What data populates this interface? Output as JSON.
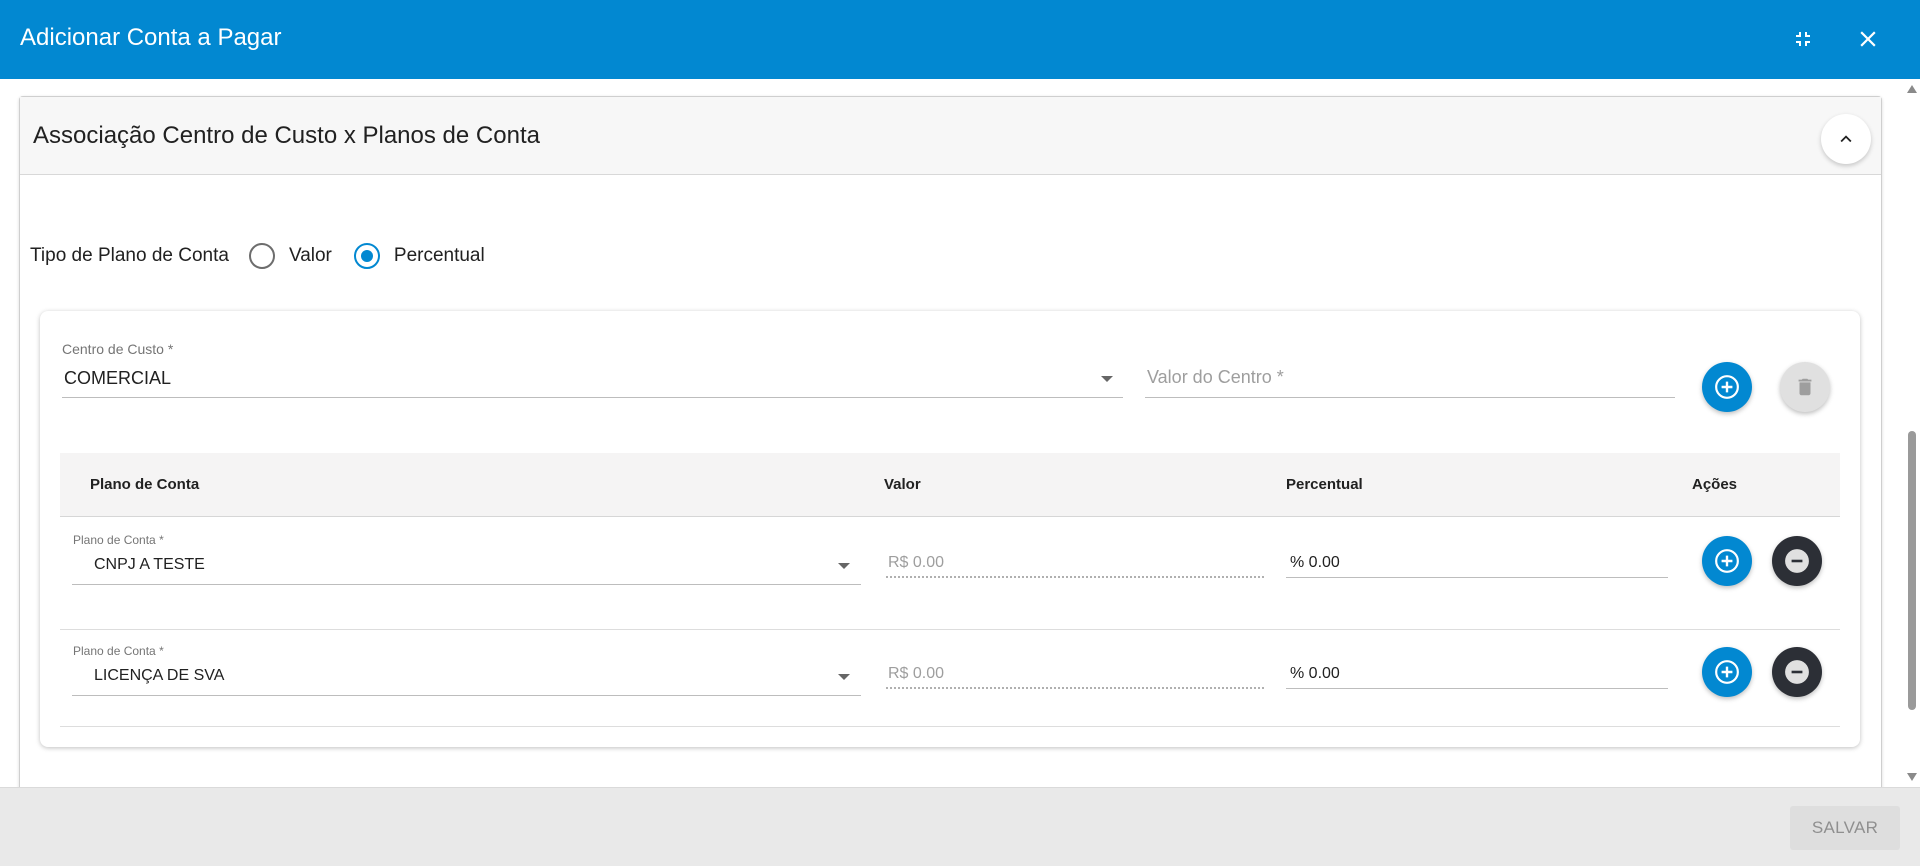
{
  "dialog": {
    "title": "Adicionar Conta a Pagar"
  },
  "panel": {
    "title": "Associação Centro de Custo x Planos de Conta"
  },
  "tipo_plano": {
    "label": "Tipo de Plano de Conta",
    "options": [
      {
        "label": "Valor",
        "selected": false
      },
      {
        "label": "Percentual",
        "selected": true
      }
    ]
  },
  "centro": {
    "label": "Centro de Custo",
    "required_mark": "*",
    "value": "COMERCIAL",
    "valor_label": "Valor do Centro",
    "valor_required_mark": "*"
  },
  "table": {
    "headers": [
      "Plano de Conta",
      "Valor",
      "Percentual",
      "Ações"
    ],
    "rows": [
      {
        "field_label": "Plano de Conta *",
        "plano": "CNPJ A TESTE",
        "valor": "R$ 0.00",
        "percentual": "% 0.00"
      },
      {
        "field_label": "Plano de Conta *",
        "plano": "LICENÇA DE SVA",
        "valor": "R$ 0.00",
        "percentual": "% 0.00"
      }
    ]
  },
  "footer": {
    "save_label": "SALVAR"
  },
  "colors": {
    "primary": "#0288d1",
    "remove_button": "#2c2f36",
    "disabled_button": "#dedede"
  },
  "icons": {
    "minimize": "fullscreen-exit-icon",
    "close": "close-icon",
    "collapse": "chevron-up-icon",
    "add": "plus-circle-icon",
    "delete": "trash-icon",
    "remove": "minus-circle-icon"
  }
}
